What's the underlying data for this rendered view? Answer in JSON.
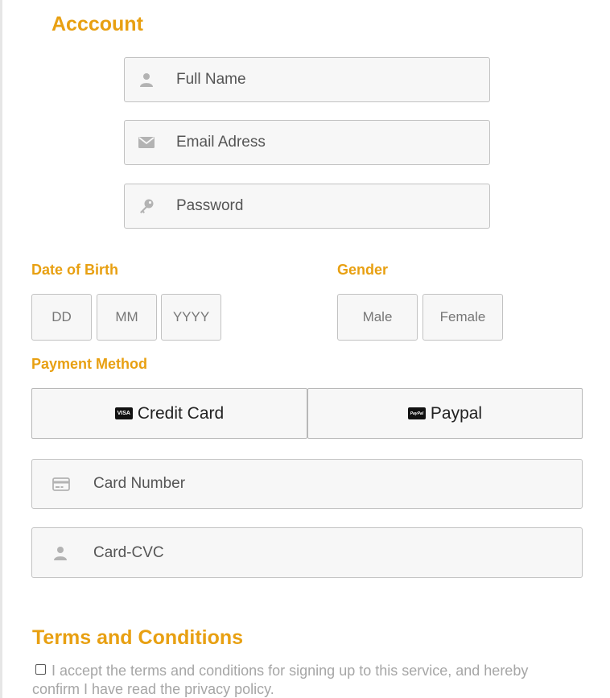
{
  "account": {
    "title": "Acccount",
    "full_name_placeholder": "Full Name",
    "email_placeholder": "Email Adress",
    "password_placeholder": "Password"
  },
  "dob": {
    "label": "Date of Birth",
    "day": "DD",
    "month": "MM",
    "year": "YYYY"
  },
  "gender": {
    "label": "Gender",
    "male": "Male",
    "female": "Female"
  },
  "payment": {
    "label": "Payment Method",
    "credit_card": "Credit Card",
    "credit_card_badge": "VISA",
    "paypal": "Paypal",
    "paypal_badge": "PayPal",
    "card_number_placeholder": "Card Number",
    "card_cvc_placeholder": "Card-CVC"
  },
  "terms": {
    "title": "Terms and Conditions",
    "text": "I accept the terms and conditions for signing up to this service, and hereby confirm I have read the privacy policy."
  },
  "colors": {
    "accent": "#e8a012",
    "field_bg": "#f7f7f7",
    "border": "#c2c2c2",
    "icon": "#b3b3b3"
  }
}
